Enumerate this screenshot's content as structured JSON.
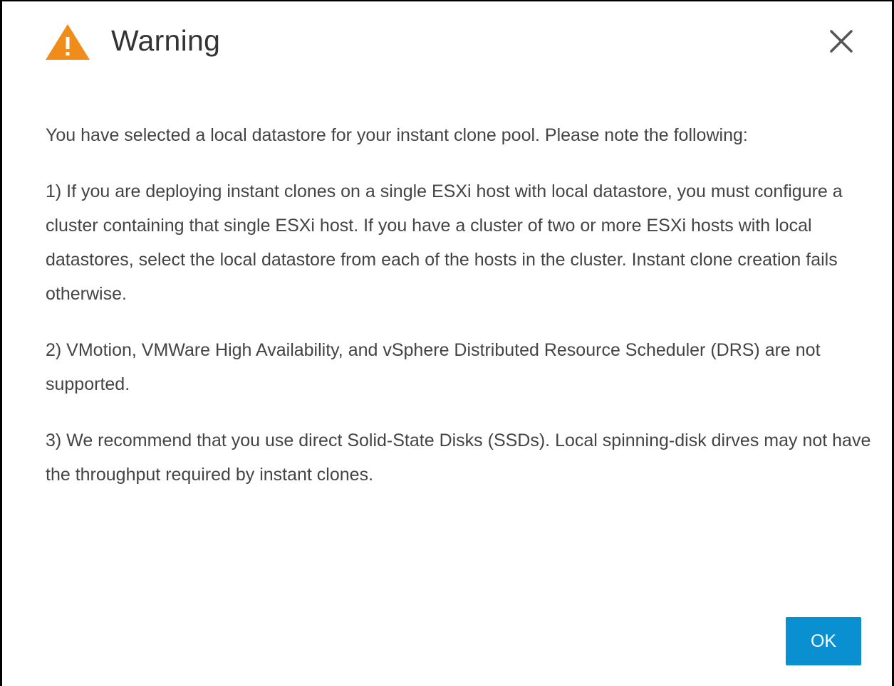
{
  "dialog": {
    "title": "Warning",
    "title_icon": "warning-triangle-icon",
    "close_icon": "close-icon",
    "colors": {
      "warning_icon": "#f08c1a",
      "primary_button": "#0a8fd1",
      "text": "#444444",
      "title": "#333333"
    },
    "paragraphs": [
      "You have selected a local datastore for your instant clone pool. Please note the following:",
      "1) If you are deploying instant clones on a single ESXi host with local datastore, you must configure a cluster containing that single ESXi host. If you have a cluster of two or more ESXi hosts with local datastores, select the local datastore from each of the hosts in the cluster. Instant clone creation fails otherwise.",
      "2) VMotion, VMWare High Availability, and vSphere Distributed Resource Scheduler (DRS) are not supported.",
      "3) We recommend that you use direct Solid-State Disks (SSDs). Local spinning-disk dirves may not have the throughput required by instant clones."
    ],
    "ok_label": "OK"
  }
}
